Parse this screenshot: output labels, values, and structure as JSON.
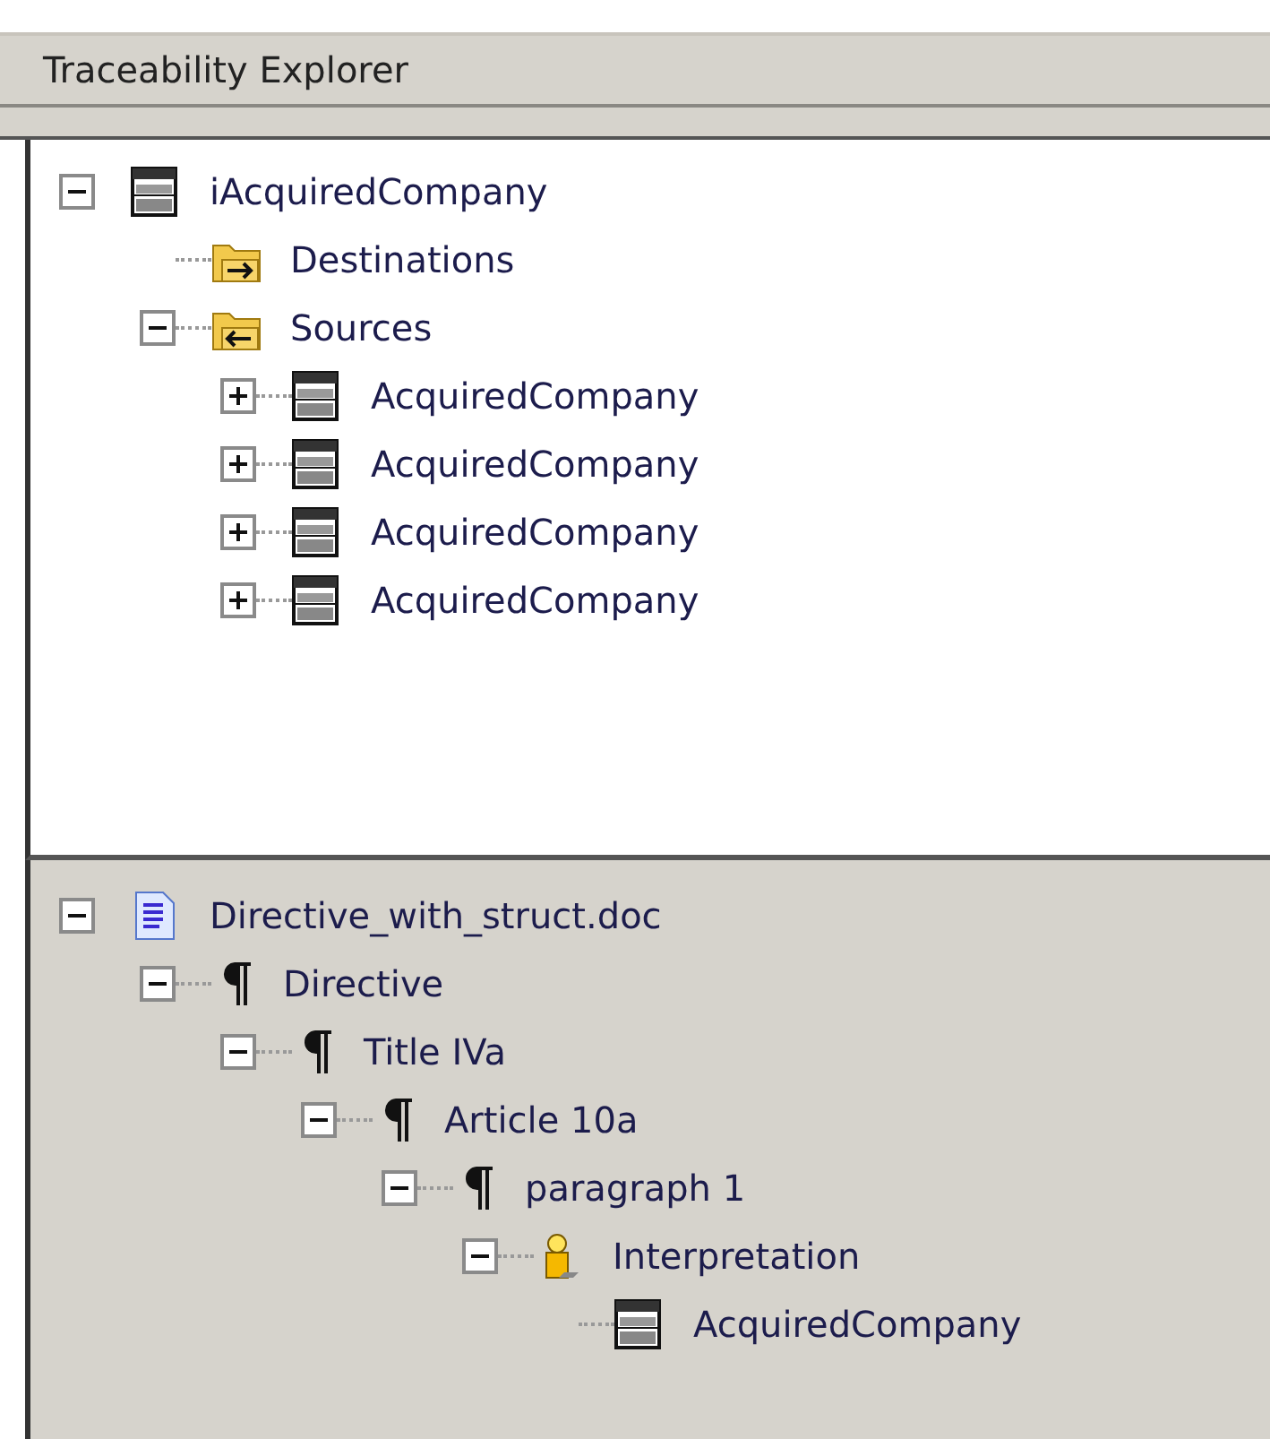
{
  "panel": {
    "title": "Traceability Explorer"
  },
  "trace_tree": [
    {
      "kind": "table",
      "label": "iAcquiredCompany",
      "expanded": true,
      "children": [
        {
          "kind": "folder-out",
          "label": "Destinations"
        },
        {
          "kind": "folder-in",
          "label": "Sources",
          "expanded": true,
          "children": [
            {
              "kind": "table",
              "label": "AcquiredCompany",
              "expanded": false
            },
            {
              "kind": "table",
              "label": "AcquiredCompany",
              "expanded": false
            },
            {
              "kind": "table",
              "label": "AcquiredCompany",
              "expanded": false
            },
            {
              "kind": "table",
              "label": "AcquiredCompany",
              "expanded": false
            }
          ]
        }
      ]
    }
  ],
  "document_tree": [
    {
      "kind": "document",
      "label": "Directive_with_struct.doc",
      "expanded": true,
      "children": [
        {
          "kind": "paragraph",
          "label": "Directive",
          "expanded": true,
          "children": [
            {
              "kind": "paragraph",
              "label": "Title IVa",
              "expanded": true,
              "children": [
                {
                  "kind": "paragraph",
                  "label": "Article 10a",
                  "expanded": true,
                  "children": [
                    {
                      "kind": "paragraph",
                      "label": "paragraph 1",
                      "expanded": true,
                      "children": [
                        {
                          "kind": "interpretation",
                          "label": "Interpretation",
                          "expanded": true,
                          "children": [
                            {
                              "kind": "table",
                              "label": "AcquiredCompany"
                            }
                          ]
                        }
                      ]
                    }
                  ]
                }
              ]
            }
          ]
        }
      ]
    }
  ]
}
